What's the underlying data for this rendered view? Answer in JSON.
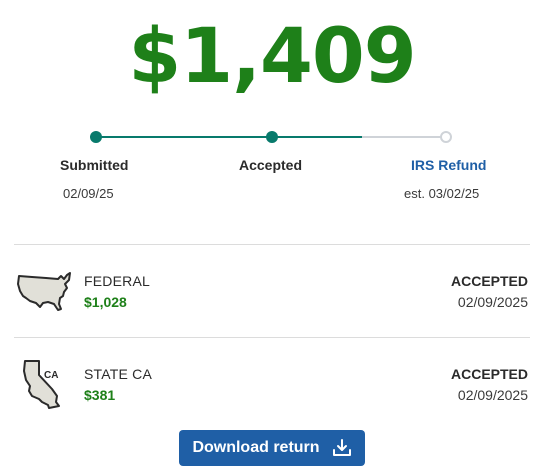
{
  "refund": {
    "total": "$1,409"
  },
  "progress": {
    "completed_fraction": 0.67,
    "steps": [
      {
        "label": "Submitted",
        "date": "02/09/25",
        "status": "complete"
      },
      {
        "label": "Accepted",
        "date": "",
        "status": "complete"
      },
      {
        "label": "IRS Refund",
        "date": "est. 03/02/25",
        "status": "pending"
      }
    ]
  },
  "returns": [
    {
      "icon": "usa-map-icon",
      "title": "FEDERAL",
      "amount": "$1,028",
      "status": "ACCEPTED",
      "date": "02/09/2025"
    },
    {
      "icon": "california-map-icon",
      "icon_label": "CA",
      "title": "STATE CA",
      "amount": "$381",
      "status": "ACCEPTED",
      "date": "02/09/2025"
    }
  ],
  "download": {
    "label": "Download return",
    "icon": "download-icon"
  },
  "colors": {
    "amount_green": "#1e8019",
    "progress_teal": "#087a6c",
    "progress_pending": "#cfd3d8",
    "link_blue": "#1f5fa6",
    "button_blue": "#1f5fa6",
    "map_fill": "#e1e0d8"
  }
}
